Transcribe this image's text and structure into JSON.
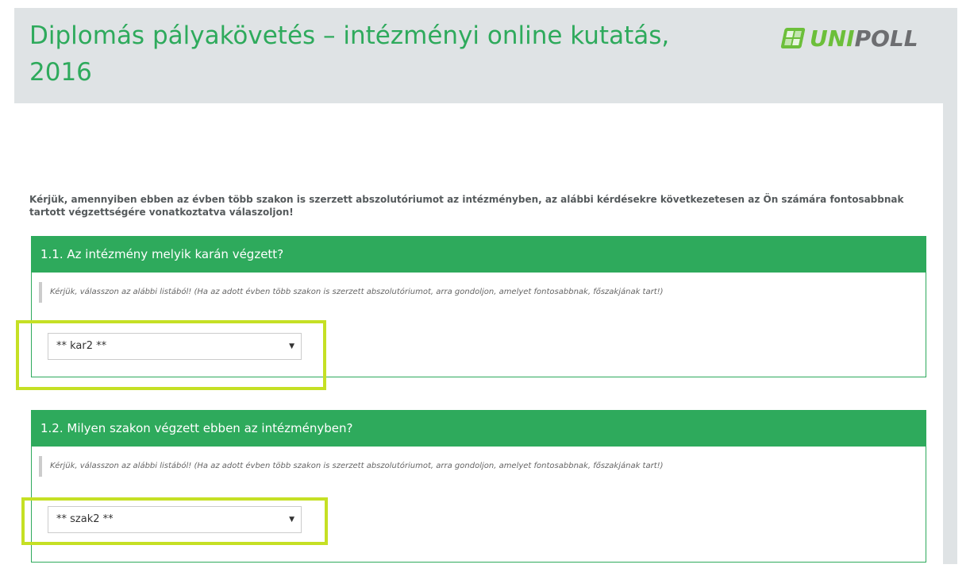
{
  "header": {
    "title": "Diplomás pályakövetés – intézményi online kutatás, 2016",
    "logo": {
      "icon": "unipoll-logo-mark",
      "text_part1": "UNI",
      "text_part2": "POLL"
    }
  },
  "intro": {
    "text": "Kérjük, amennyiben ebben az évben több szakon is szerzett abszolutóriumot az intézményben, az alábbi kérdésekre következetesen az Ön számára fontosabbnak tartott végzettségére vonatkoztatva válaszoljon!"
  },
  "questions": [
    {
      "title": "1.1. Az intézmény melyik karán végzett?",
      "help": "Kérjük, válasszon az alábbi listából! (Ha az adott évben több szakon is szerzett abszolutóriumot, arra gondoljon, amelyet fontosabbnak, főszakjának tart!)",
      "selected": "** kar2 **",
      "caret": "▼"
    },
    {
      "title": "1.2. Milyen szakon végzett ebben az intézményben?",
      "help": "Kérjük, válasszon az alábbi listából! (Ha az adott évben több szakon is szerzett abszolutóriumot, arra gondoljon, amelyet fontosabbnak, főszakjának tart!)",
      "selected": "** szak2 **",
      "caret": "▼"
    }
  ],
  "colors": {
    "brand_green": "#2eaa5c",
    "header_bg": "#dfe3e5",
    "highlight": "#c5e024",
    "logo_green": "#6cbf3a",
    "logo_grey": "#6d6e71"
  }
}
